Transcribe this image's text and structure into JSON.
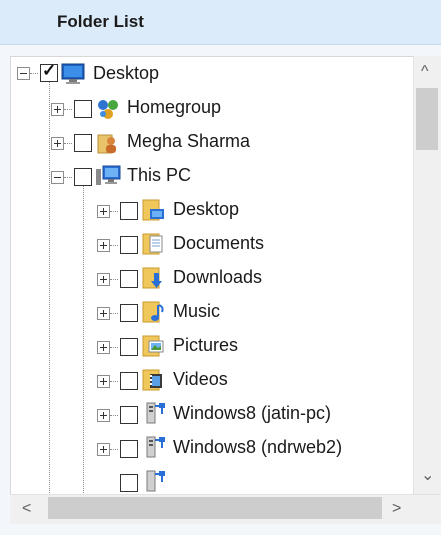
{
  "header": {
    "title": "Folder List"
  },
  "tree": {
    "items": [
      {
        "label": "Desktop",
        "icon": "monitor-icon",
        "checked": true,
        "expanded": true
      },
      {
        "label": "Homegroup",
        "icon": "homegroup-icon",
        "checked": false,
        "expanded": false
      },
      {
        "label": "Megha Sharma",
        "icon": "user-folder-icon",
        "checked": false,
        "expanded": false
      },
      {
        "label": "This PC",
        "icon": "computer-icon",
        "checked": false,
        "expanded": true
      },
      {
        "label": "Desktop",
        "icon": "desktop-folder-icon",
        "checked": false,
        "expanded": false
      },
      {
        "label": "Documents",
        "icon": "documents-folder-icon",
        "checked": false,
        "expanded": false
      },
      {
        "label": "Downloads",
        "icon": "downloads-folder-icon",
        "checked": false,
        "expanded": false
      },
      {
        "label": "Music",
        "icon": "music-folder-icon",
        "checked": false,
        "expanded": false
      },
      {
        "label": "Pictures",
        "icon": "pictures-folder-icon",
        "checked": false,
        "expanded": false
      },
      {
        "label": "Videos",
        "icon": "videos-folder-icon",
        "checked": false,
        "expanded": false
      },
      {
        "label": "Windows8 (jatin-pc)",
        "icon": "network-drive-icon",
        "checked": false,
        "expanded": false
      },
      {
        "label": "Windows8 (ndrweb2)",
        "icon": "network-drive-icon",
        "checked": false,
        "expanded": false
      }
    ]
  },
  "scroll": {
    "up": "^",
    "down": "⌄",
    "left": "<",
    "right": ">"
  },
  "colors": {
    "header_bg": "#dcebf9",
    "tree_bg": "#ffffff",
    "scrollbar": "#f0f0f0",
    "thumb": "#cdcdcd"
  }
}
